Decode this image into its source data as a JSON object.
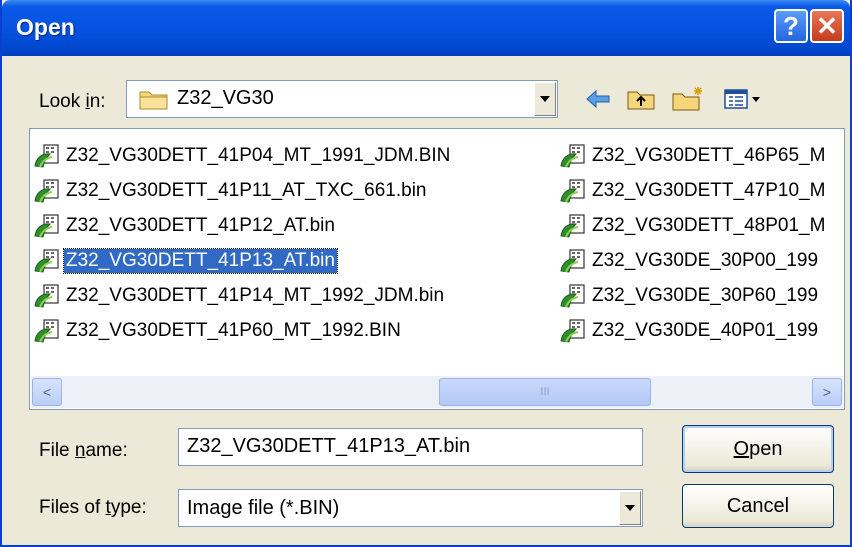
{
  "window": {
    "title": "Open",
    "help_label": "?",
    "close_label": "✕"
  },
  "lookin": {
    "label_pre": "Look ",
    "label_key": "i",
    "label_post": "n:",
    "value": "Z32_VG30"
  },
  "toolbar": {
    "back_icon": "back-arrow-icon",
    "up_icon": "up-folder-icon",
    "new_folder_icon": "new-folder-icon",
    "view_menu_icon": "view-menu-icon"
  },
  "files": [
    "Z32_VG30DETT_41P04_MT_1991_JDM.BIN",
    "Z32_VG30DETT_41P11_AT_TXC_661.bin",
    "Z32_VG30DETT_41P12_AT.bin",
    "Z32_VG30DETT_41P13_AT.bin",
    "Z32_VG30DETT_41P14_MT_1992_JDM.bin",
    "Z32_VG30DETT_41P60_MT_1992.BIN",
    "Z32_VG30DETT_46P65_M",
    "Z32_VG30DETT_47P10_M",
    "Z32_VG30DETT_48P01_M",
    "Z32_VG30DE_30P00_199",
    "Z32_VG30DE_30P60_199",
    "Z32_VG30DE_40P01_199"
  ],
  "selected_index": 3,
  "scrollbar": {
    "left_arrow": "<",
    "right_arrow": ">",
    "grip": "III"
  },
  "filename": {
    "label_pre": "File ",
    "label_key": "n",
    "label_post": "ame:",
    "value": "Z32_VG30DETT_41P13_AT.bin"
  },
  "filetype": {
    "label_pre": "Files of ",
    "label_key": "t",
    "label_post": "ype:",
    "value": "Image file (*.BIN)"
  },
  "buttons": {
    "open_key": "O",
    "open_rest": "pen",
    "cancel": "Cancel"
  },
  "colors": {
    "titlebar": "#0a59e8",
    "selection": "#316ac5",
    "dialog_bg": "#ece9d8"
  }
}
